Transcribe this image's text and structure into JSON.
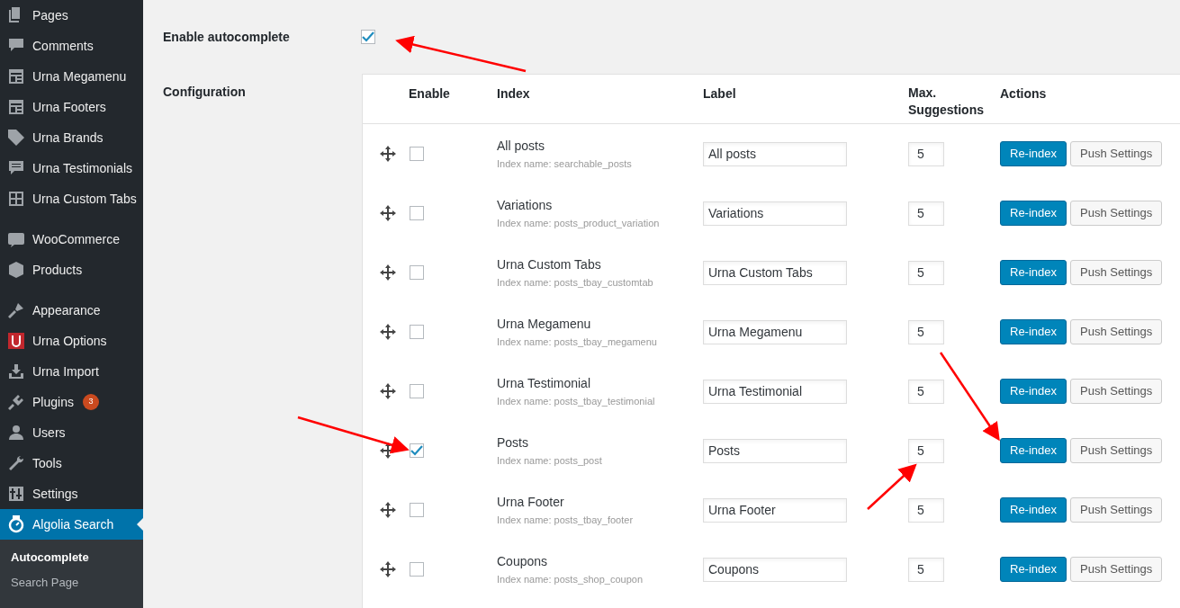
{
  "sidebar": {
    "menu_groups": [
      [
        {
          "label": "Pages",
          "selected": false
        },
        {
          "label": "Comments",
          "selected": false
        },
        {
          "label": "Urna Megamenu",
          "selected": false
        },
        {
          "label": "Urna Footers",
          "selected": false
        },
        {
          "label": "Urna Brands",
          "selected": false
        },
        {
          "label": "Urna Testimonials",
          "selected": false
        },
        {
          "label": "Urna Custom Tabs",
          "selected": false
        }
      ],
      [
        {
          "label": "WooCommerce",
          "selected": false
        },
        {
          "label": "Products",
          "selected": false
        }
      ],
      [
        {
          "label": "Appearance",
          "selected": false
        },
        {
          "label": "Urna Options",
          "selected": false
        },
        {
          "label": "Urna Import",
          "selected": false
        },
        {
          "label": "Plugins",
          "selected": false,
          "badge": "3"
        },
        {
          "label": "Users",
          "selected": false
        },
        {
          "label": "Tools",
          "selected": false
        },
        {
          "label": "Settings",
          "selected": false
        },
        {
          "label": "Algolia Search",
          "selected": true
        }
      ]
    ],
    "submenu": [
      {
        "label": "Autocomplete",
        "selected": true
      },
      {
        "label": "Search Page",
        "selected": false
      }
    ]
  },
  "settings": {
    "enable_autocomplete": {
      "label": "Enable autocomplete",
      "checked": true
    },
    "configuration_label": "Configuration"
  },
  "table": {
    "columns": [
      "Enable",
      "Index",
      "Label",
      "Max. Suggestions",
      "Actions"
    ],
    "rows": [
      {
        "enabled": false,
        "index": "All posts",
        "index_name": "Index name: searchable_posts",
        "label": "All posts",
        "max": "5",
        "reindex": "Re-index",
        "push": "Push Settings"
      },
      {
        "enabled": false,
        "index": "Variations",
        "index_name": "Index name: posts_product_variation",
        "label": "Variations",
        "max": "5",
        "reindex": "Re-index",
        "push": "Push Settings"
      },
      {
        "enabled": false,
        "index": "Urna Custom Tabs",
        "index_name": "Index name: posts_tbay_customtab",
        "label": "Urna Custom Tabs",
        "max": "5",
        "reindex": "Re-index",
        "push": "Push Settings"
      },
      {
        "enabled": false,
        "index": "Urna Megamenu",
        "index_name": "Index name: posts_tbay_megamenu",
        "label": "Urna Megamenu",
        "max": "5",
        "reindex": "Re-index",
        "push": "Push Settings"
      },
      {
        "enabled": false,
        "index": "Urna Testimonial",
        "index_name": "Index name: posts_tbay_testimonial",
        "label": "Urna Testimonial",
        "max": "5",
        "reindex": "Re-index",
        "push": "Push Settings"
      },
      {
        "enabled": true,
        "index": "Posts",
        "index_name": "Index name: posts_post",
        "label": "Posts",
        "max": "5",
        "reindex": "Re-index",
        "push": "Push Settings"
      },
      {
        "enabled": false,
        "index": "Urna Footer",
        "index_name": "Index name: posts_tbay_footer",
        "label": "Urna Footer",
        "max": "5",
        "reindex": "Re-index",
        "push": "Push Settings"
      },
      {
        "enabled": false,
        "index": "Coupons",
        "index_name": "Index name: posts_shop_coupon",
        "label": "Coupons",
        "max": "5",
        "reindex": "Re-index",
        "push": "Push Settings"
      }
    ]
  }
}
